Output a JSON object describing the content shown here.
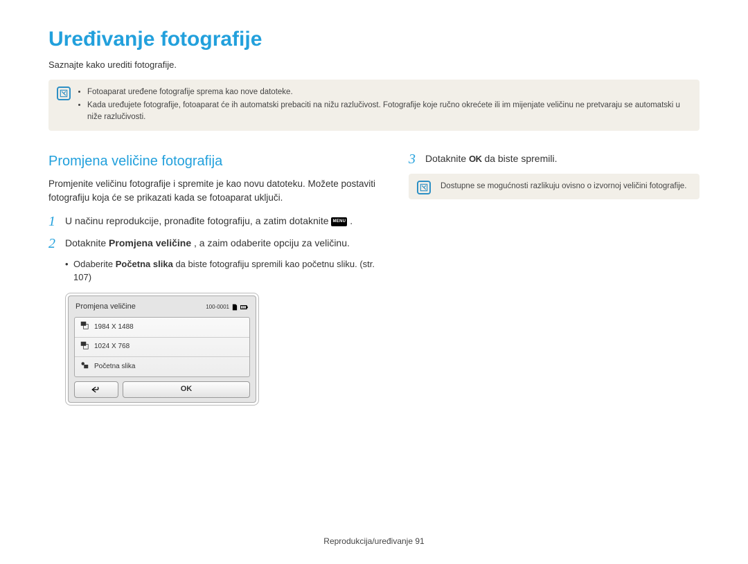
{
  "page": {
    "title": "Uređivanje fotografije",
    "intro": "Saznajte kako urediti fotografije."
  },
  "top_note": {
    "items": [
      "Fotoaparat uređene fotografije sprema kao nove datoteke.",
      "Kada uređujete fotografije, fotoaparat će ih automatski prebaciti na nižu razlučivost. Fotografije koje ručno okrećete ili im mijenjate veličinu ne pretvaraju se automatski u niže razlučivosti."
    ]
  },
  "section": {
    "heading": "Promjena veličine fotografija",
    "desc": "Promjenite veličinu fotografije i spremite je kao novu datoteku. Možete postaviti fotografiju koja će se prikazati kada se fotoaparat uključi."
  },
  "steps": {
    "s1_num": "1",
    "s1_a": "U načinu reprodukcije, pronađite fotografiju, a zatim dotaknite ",
    "s1_menu": "MENU",
    "s1_b": ".",
    "s2_num": "2",
    "s2_a": "Dotaknite ",
    "s2_bold": "Promjena veličine",
    "s2_b": ", a zaim odaberite opciju za veličinu.",
    "s2_sub_a": "Odaberite ",
    "s2_sub_bold": "Početna slika",
    "s2_sub_b": " da biste fotografiju spremili kao početnu sliku. (str. 107)",
    "s3_num": "3",
    "s3_a": "Dotaknite ",
    "s3_ok": "OK",
    "s3_b": " da biste spremili."
  },
  "lcd": {
    "title": "Promjena veličine",
    "counter": "100-0001",
    "options": {
      "o1": "1984 X 1488",
      "o2": "1024 X 768",
      "o3": "Početna slika"
    },
    "ok": "OK"
  },
  "right_note": "Dostupne se mogućnosti razlikuju ovisno o izvornoj veličini fotografije.",
  "footer": {
    "label": "Reprodukcija/uređivanje ",
    "page_no": "91"
  }
}
